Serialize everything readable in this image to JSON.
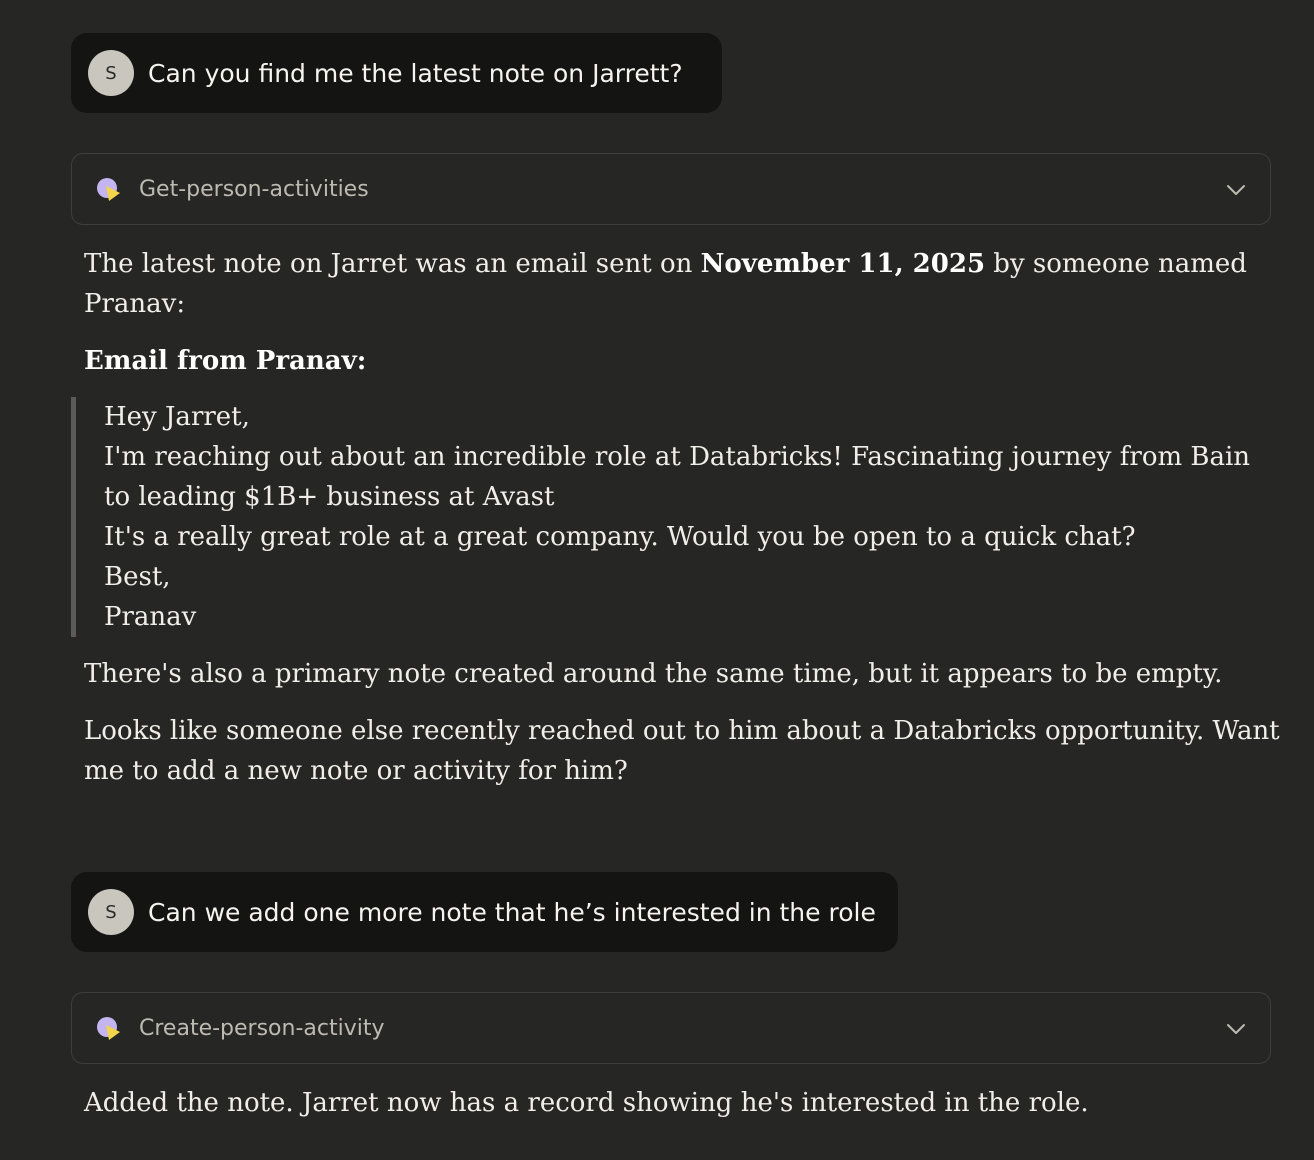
{
  "conversation": {
    "msg1": {
      "avatar_initial": "S",
      "text": "Can you find me the latest note on Jarrett?"
    },
    "tool1": {
      "label": "Get-person-activities",
      "icon": "tool-pie-icon",
      "chevron": "chevron-down-icon"
    },
    "reply1": {
      "intro_before": "The latest note on Jarret was an email sent on ",
      "intro_date": "November 11, 2025",
      "intro_after": " by someone named",
      "intro_line2": "Pranav:",
      "email_heading": "Email from Pranav:",
      "email_lines": [
        "Hey Jarret,",
        "I'm reaching out about an incredible role at Databricks! Fascinating journey from Bain",
        "to leading $1B+ business at Avast",
        "It's a really great role at a great company. Would you be open to a quick chat?",
        "Best,",
        "Pranav"
      ],
      "paragraph2": "There's also a primary note created around the same time, but it appears to be empty.",
      "paragraph3_line1": "Looks like someone else recently reached out to him about a Databricks opportunity. Want",
      "paragraph3_line2": "me to add a new note or activity for him?"
    },
    "msg2": {
      "avatar_initial": "S",
      "text": "Can we add one more note that he’s interested in the role"
    },
    "tool2": {
      "label": "Create-person-activity",
      "icon": "tool-pie-icon",
      "chevron": "chevron-down-icon"
    },
    "reply2": {
      "text": "Added the note. Jarret now has a record showing he's interested in the role."
    }
  },
  "colors": {
    "background": "#262624",
    "user_bubble": "#141413",
    "avatar": "#c8c6bd",
    "icon_purple": "#c4b5f0",
    "icon_yellow": "#f2d54a"
  }
}
